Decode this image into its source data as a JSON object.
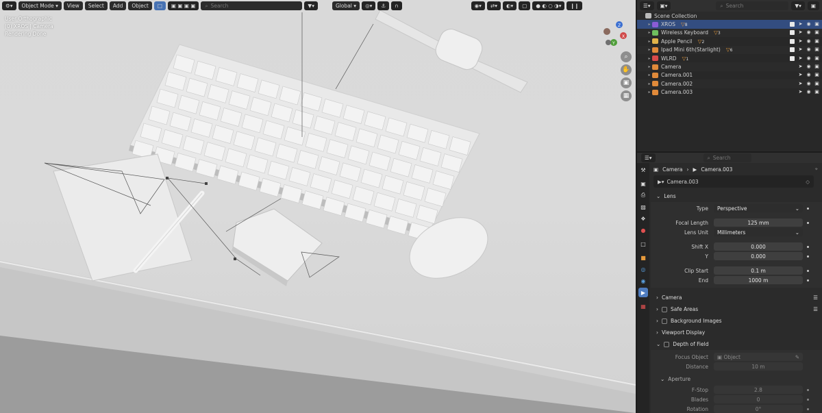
{
  "viewport": {
    "header": {
      "mode": "Object Mode",
      "menu": [
        "View",
        "Select",
        "Add",
        "Object"
      ],
      "search_placeholder": "Search",
      "transform_orientation": "Global"
    },
    "overlay": {
      "line1": "User Orthographic",
      "line2": "(0) XROS | Camera",
      "line3": "Rendering Done"
    },
    "gizmo": {
      "x": "X",
      "y": "Y",
      "z": "Z"
    }
  },
  "outliner": {
    "search_placeholder": "Search",
    "collection": "Scene Collection",
    "items": [
      {
        "name": "XROS",
        "badge": "8",
        "selected": true,
        "color": "#8a5cd6"
      },
      {
        "name": "Wireless Keyboard",
        "badge": "3",
        "selected": false,
        "color": "#6fbf5e"
      },
      {
        "name": "Apple Pencil",
        "badge": "2",
        "selected": false,
        "color": "#e0b34a"
      },
      {
        "name": "Ipad Mini 6th(Starlight)",
        "badge": "6",
        "selected": false,
        "color": "#e08a3a"
      },
      {
        "name": "WLRD",
        "badge": "1",
        "selected": false,
        "color": "#d94a4a"
      },
      {
        "name": "Camera",
        "badge": "",
        "selected": false,
        "color": "#e08a3a"
      },
      {
        "name": "Camera.001",
        "badge": "",
        "selected": false,
        "color": "#e08a3a"
      },
      {
        "name": "Camera.002",
        "badge": "",
        "selected": false,
        "color": "#e08a3a"
      },
      {
        "name": "Camera.003",
        "badge": "",
        "selected": false,
        "color": "#e08a3a"
      }
    ]
  },
  "properties": {
    "search_placeholder": "Search",
    "breadcrumb": [
      "Camera",
      "Camera.003"
    ],
    "datablock": "Camera.003",
    "lens": {
      "title": "Lens",
      "type_label": "Type",
      "type_value": "Perspective",
      "focal_label": "Focal Length",
      "focal_value": "125 mm",
      "unit_label": "Lens Unit",
      "unit_value": "Millimeters",
      "shiftx_label": "Shift X",
      "shiftx_value": "0.000",
      "shifty_label": "Y",
      "shifty_value": "0.000",
      "clipstart_label": "Clip Start",
      "clipstart_value": "0.1 m",
      "clipend_label": "End",
      "clipend_value": "1000 m"
    },
    "panels": [
      "Camera",
      "Safe Areas",
      "Background Images",
      "Viewport Display",
      "Depth of Field"
    ],
    "dof": {
      "focus_label": "Focus Object",
      "focus_placeholder": "Object",
      "distance_label": "Distance",
      "distance_value": "10 m",
      "aperture_title": "Aperture",
      "fstop_label": "F-Stop",
      "fstop_value": "2.8",
      "blades_label": "Blades",
      "blades_value": "0",
      "rotation_label": "Rotation",
      "rotation_value": "0°"
    }
  }
}
